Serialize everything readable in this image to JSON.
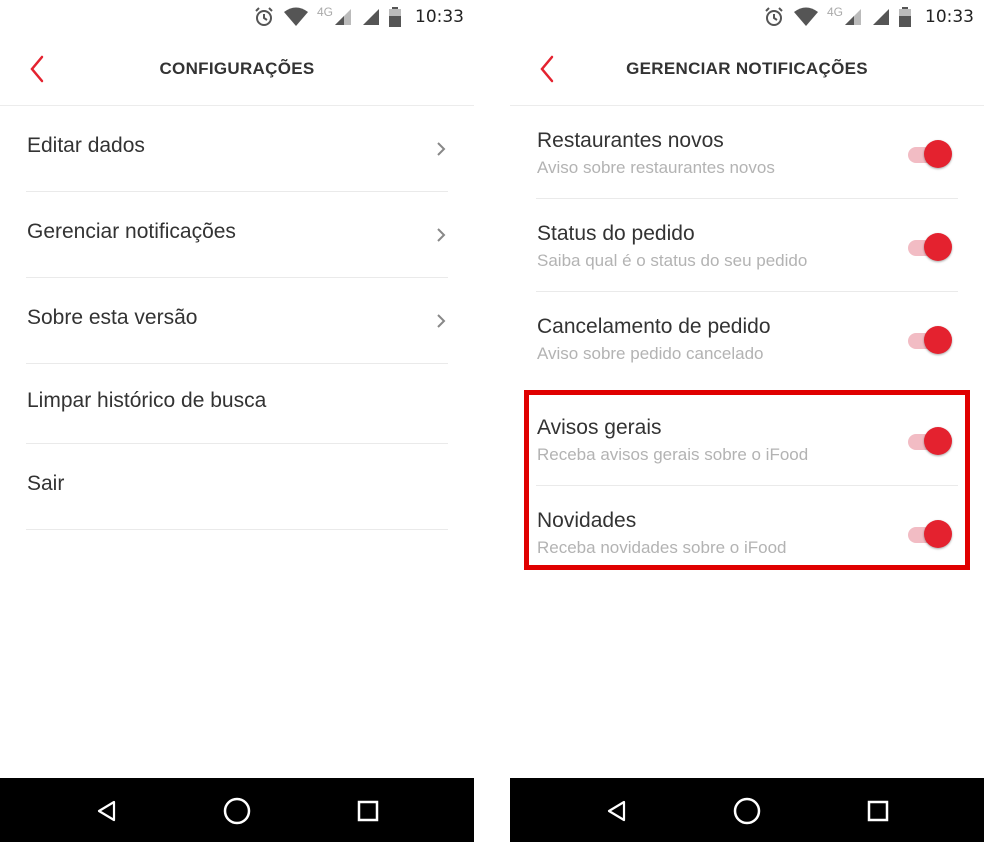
{
  "status_bar": {
    "time": "10:33",
    "network": "4G"
  },
  "left_screen": {
    "title": "CONFIGURAÇÕES",
    "items": [
      {
        "label": "Editar dados",
        "has_chevron": true
      },
      {
        "label": "Gerenciar notificações",
        "has_chevron": true
      },
      {
        "label": "Sobre esta versão",
        "has_chevron": true
      },
      {
        "label": "Limpar histórico de busca",
        "has_chevron": false
      },
      {
        "label": "Sair",
        "has_chevron": false
      }
    ]
  },
  "right_screen": {
    "title": "GERENCIAR NOTIFICAÇÕES",
    "items": [
      {
        "title": "Restaurantes novos",
        "subtitle": "Aviso sobre restaurantes novos",
        "enabled": true
      },
      {
        "title": "Status do pedido",
        "subtitle": "Saiba qual é o status do seu pedido",
        "enabled": true
      },
      {
        "title": "Cancelamento de pedido",
        "subtitle": "Aviso sobre pedido cancelado",
        "enabled": true
      },
      {
        "title": "Avisos gerais",
        "subtitle": "Receba avisos gerais sobre o iFood",
        "enabled": true
      },
      {
        "title": "Novidades",
        "subtitle": "Receba novidades sobre o iFood",
        "enabled": true
      }
    ]
  },
  "colors": {
    "accent": "#e4222f",
    "toggle_track": "#f2bcc4",
    "highlight_border": "#e00000",
    "navbar": "#000000"
  },
  "icons": [
    "alarm-icon",
    "wifi-icon",
    "signal-icon",
    "battery-icon",
    "back-arrow-icon",
    "chevron-right-icon",
    "nav-back-icon",
    "nav-home-icon",
    "nav-recents-icon"
  ]
}
